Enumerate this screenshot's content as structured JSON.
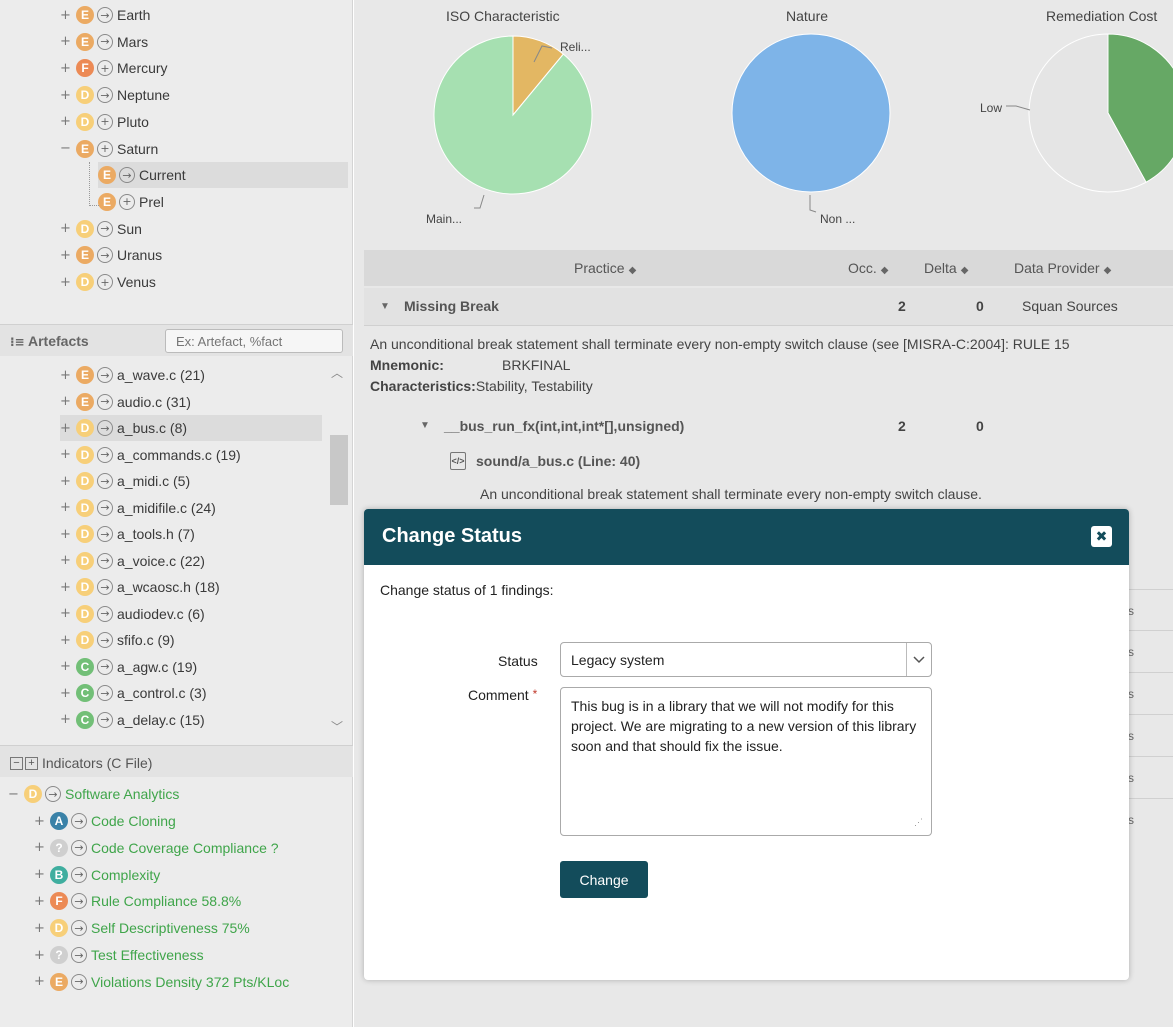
{
  "project_tree": [
    {
      "pm": "+",
      "grade": "E",
      "nav": "→",
      "label": "Earth"
    },
    {
      "pm": "+",
      "grade": "E",
      "nav": "→",
      "label": "Mars"
    },
    {
      "pm": "+",
      "grade": "F",
      "nav": "+",
      "label": "Mercury"
    },
    {
      "pm": "+",
      "grade": "D",
      "nav": "→",
      "label": "Neptune"
    },
    {
      "pm": "+",
      "grade": "D",
      "nav": "+",
      "label": "Pluto"
    },
    {
      "pm": "−",
      "grade": "E",
      "nav": "+",
      "label": "Saturn"
    },
    {
      "pm": "",
      "grade": "E",
      "nav": "→",
      "label": "Current"
    },
    {
      "pm": "",
      "grade": "E",
      "nav": "+",
      "label": "Prel"
    },
    {
      "pm": "+",
      "grade": "D",
      "nav": "→",
      "label": "Sun"
    },
    {
      "pm": "+",
      "grade": "E",
      "nav": "→",
      "label": "Uranus"
    },
    {
      "pm": "+",
      "grade": "D",
      "nav": "+",
      "label": "Venus"
    }
  ],
  "artefacts": {
    "title": "Artefacts",
    "search_placeholder": "Ex: Artefact, %fact",
    "items": [
      {
        "grade": "E",
        "label": "a_wave.c (21)"
      },
      {
        "grade": "E",
        "label": "audio.c (31)"
      },
      {
        "grade": "D",
        "label": "a_bus.c (8)"
      },
      {
        "grade": "D",
        "label": "a_commands.c (19)"
      },
      {
        "grade": "D",
        "label": "a_midi.c (5)"
      },
      {
        "grade": "D",
        "label": "a_midifile.c (24)"
      },
      {
        "grade": "D",
        "label": "a_tools.h (7)"
      },
      {
        "grade": "D",
        "label": "a_voice.c (22)"
      },
      {
        "grade": "D",
        "label": "a_wcaosc.h (18)"
      },
      {
        "grade": "D",
        "label": "audiodev.c (6)"
      },
      {
        "grade": "D",
        "label": "sfifo.c (9)"
      },
      {
        "grade": "C",
        "label": "a_agw.c (19)"
      },
      {
        "grade": "C",
        "label": "a_control.c (3)"
      },
      {
        "grade": "C",
        "label": "a_delay.c (15)"
      }
    ]
  },
  "indicators": {
    "title": "Indicators (C File)",
    "root": {
      "grade": "D",
      "label": "Software Analytics"
    },
    "items": [
      {
        "grade": "A",
        "label": "Code Cloning"
      },
      {
        "grade": "?",
        "label": "Code Coverage Compliance ?"
      },
      {
        "grade": "B",
        "label": "Complexity"
      },
      {
        "grade": "F",
        "label": "Rule Compliance 58.8%"
      },
      {
        "grade": "D",
        "label": "Self Descriptiveness 75%"
      },
      {
        "grade": "?",
        "label": "Test Effectiveness"
      },
      {
        "grade": "E",
        "label": "Violations Density 372 Pts/KLoc"
      }
    ]
  },
  "charts": {
    "iso": {
      "title": "ISO Characteristic",
      "labels": [
        "Reli...",
        "Main..."
      ]
    },
    "nature": {
      "title": "Nature",
      "labels": [
        "Non ..."
      ]
    },
    "remediation": {
      "title": "Remediation Cost",
      "labels": [
        "Low"
      ]
    }
  },
  "chart_data": [
    {
      "type": "pie",
      "title": "ISO Characteristic",
      "categories": [
        "Reli...",
        "Main..."
      ],
      "values": [
        11,
        89
      ],
      "colors": [
        "#e3b763",
        "#a6e0b1"
      ]
    },
    {
      "type": "pie",
      "title": "Nature",
      "categories": [
        "Non ..."
      ],
      "values": [
        100
      ],
      "colors": [
        "#7eb4e8"
      ]
    },
    {
      "type": "pie",
      "title": "Remediation Cost",
      "categories": [
        "Low",
        ""
      ],
      "values": [
        42,
        58
      ],
      "colors": [
        "#66a865",
        "#e5e5e5"
      ]
    }
  ],
  "findings": {
    "columns": [
      "Practice",
      "Occ.",
      "Delta",
      "Data Provider"
    ],
    "sort_glyph": "◆",
    "rule": {
      "name": "Missing Break",
      "occ": "2",
      "delta": "0",
      "provider": "Squan Sources"
    },
    "description": "An unconditional break statement shall terminate every non-empty switch clause (see [MISRA-C:2004]: RULE 15",
    "mnemonic_label": "Mnemonic:",
    "mnemonic": "BRKFINAL",
    "characteristics_label": "Characteristics:",
    "characteristics": "Stability, Testability",
    "function": {
      "name": "__bus_run_fx(int,int,int*[],unsigned)",
      "occ": "2",
      "delta": "0"
    },
    "file": "sound/a_bus.c (Line: 40)",
    "detail": "An unconditional break statement shall terminate every non-empty switch clause."
  },
  "modal": {
    "title": "Change Status",
    "intro": "Change status of 1 findings:",
    "status_label": "Status",
    "status_value": "Legacy system",
    "comment_label": "Comment",
    "required_mark": "*",
    "comment": "This bug is in a library that we will not modify for this project. We are migrating to a new version of this library soon and that should fix the issue.",
    "submit_label": "Change",
    "close_glyph": "✖"
  },
  "colors": {
    "dialog_header": "#134c5b",
    "indicator_text": "#3fa54a",
    "required": "#c0392b"
  }
}
